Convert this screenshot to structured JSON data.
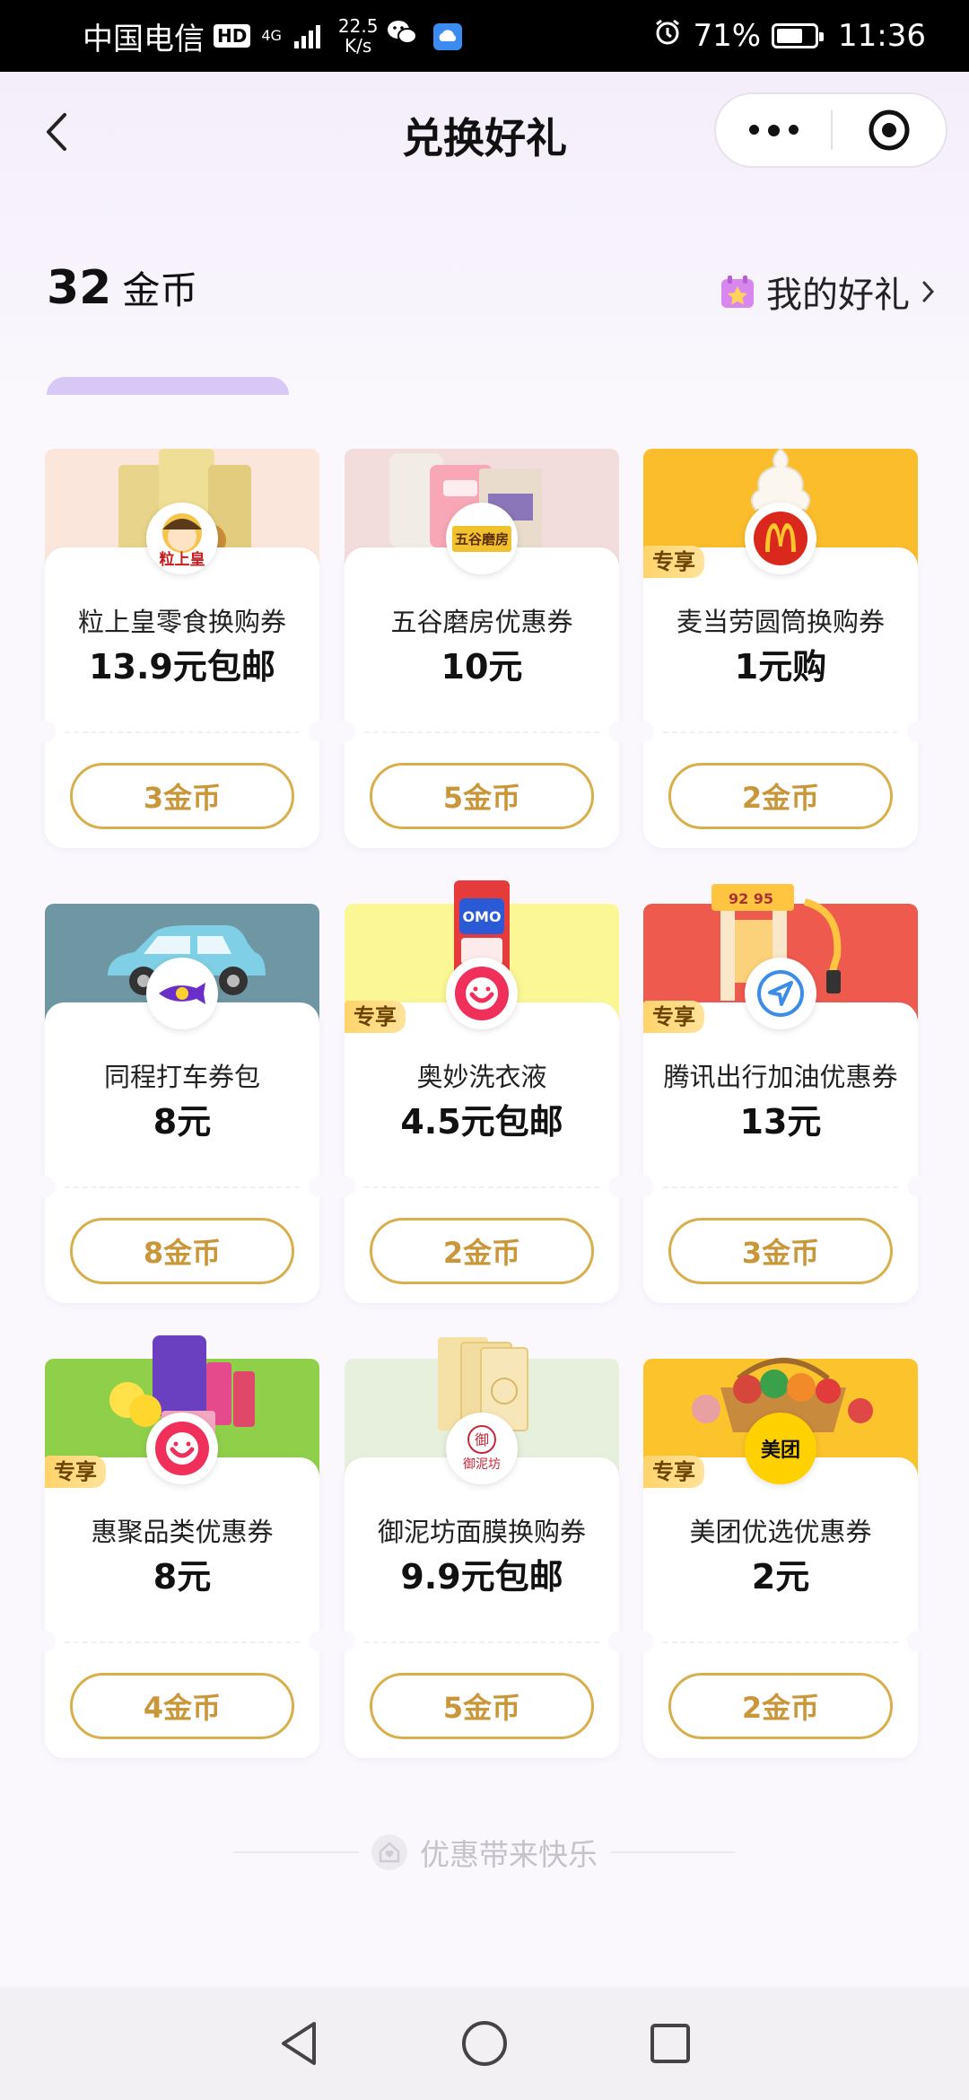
{
  "status_bar": {
    "carrier": "中国电信",
    "hd": "HD",
    "network": "4G",
    "speed_value": "22.5",
    "speed_unit": "K/s",
    "battery": "71%",
    "time": "11:36"
  },
  "header": {
    "title": "兑换好礼",
    "back_icon": "chevron-left-icon",
    "more_icon": "more-dots-icon",
    "close_icon": "target-circle-icon"
  },
  "balance": {
    "amount": "32",
    "unit": "金币"
  },
  "my_gifts": {
    "label": "我的好礼",
    "icon": "gift-calendar-icon"
  },
  "products": [
    {
      "name": "粒上皇零食换购券",
      "price": "13.9元包邮",
      "cost": "3金币",
      "exclusive": false,
      "banner_color": "#fbe6dc"
    },
    {
      "name": "五谷磨房优惠券",
      "price": "10元",
      "cost": "5金币",
      "exclusive": false,
      "banner_color": "#f3dcdc"
    },
    {
      "name": "麦当劳圆筒换购券",
      "price": "1元购",
      "cost": "2金币",
      "exclusive": true,
      "tag": "专享",
      "banner_color": "#fbbd2b"
    },
    {
      "name": "同程打车券包",
      "price": "8元",
      "cost": "8金币",
      "exclusive": false,
      "banner_color": "#6f97a3"
    },
    {
      "name": "奥妙洗衣液",
      "price": "4.5元包邮",
      "cost": "2金币",
      "exclusive": true,
      "tag": "专享",
      "banner_color": "#fbf794"
    },
    {
      "name": "腾讯出行加油优惠券",
      "price": "13元",
      "cost": "3金币",
      "exclusive": true,
      "tag": "专享",
      "banner_color": "#ef5a4f"
    },
    {
      "name": "惠聚品类优惠券",
      "price": "8元",
      "cost": "4金币",
      "exclusive": true,
      "tag": "专享",
      "banner_color": "#8fcf4a"
    },
    {
      "name": "御泥坊面膜换购券",
      "price": "9.9元包邮",
      "cost": "5金币",
      "exclusive": false,
      "banner_color": "#e6f0dc"
    },
    {
      "name": "美团优选优惠券",
      "price": "2元",
      "cost": "2金币",
      "exclusive": true,
      "tag": "专享",
      "banner_color": "#fbc42d"
    }
  ],
  "logos": {
    "p0": "粒上皇",
    "p1": "五谷磨房",
    "p7": "御泥坊",
    "p8": "美团"
  },
  "footer": {
    "slogan": "优惠带来快乐"
  },
  "colors": {
    "accent_gold": "#c9973a",
    "button_border": "#d9ae4c",
    "tag_bg": "#ffd36b"
  }
}
